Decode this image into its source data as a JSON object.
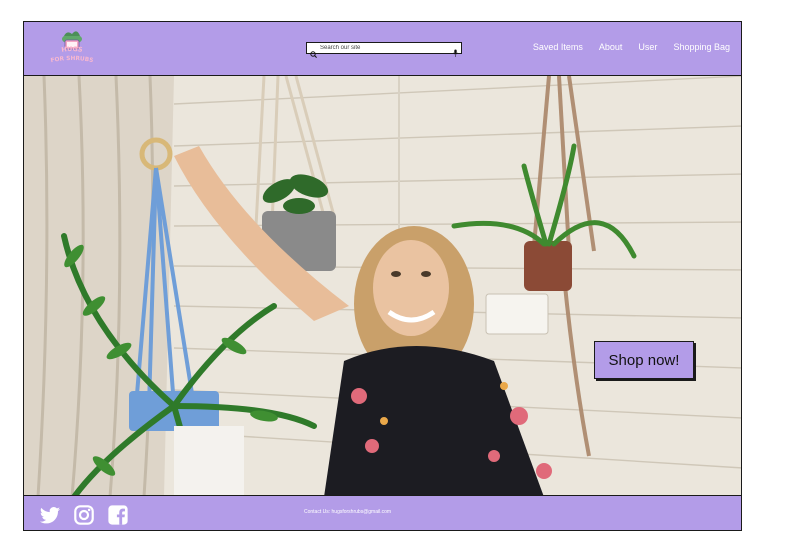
{
  "header": {
    "logo_text": "Hugs for Shrubs",
    "search": {
      "placeholder": "Search our site",
      "value": ""
    },
    "nav": [
      {
        "label": "Saved Items"
      },
      {
        "label": "About"
      },
      {
        "label": "User"
      },
      {
        "label": "Shopping Bag"
      }
    ]
  },
  "hero": {
    "shop_button_label": "Shop now!"
  },
  "footer": {
    "contact": "Contact Us: hugsforshrubs@gmail.com",
    "social_icons": [
      "twitter-icon",
      "instagram-icon",
      "facebook-icon"
    ]
  },
  "colors": {
    "accent": "#b39ce8",
    "text_light": "#ffffff",
    "border": "#1a1a1a"
  }
}
